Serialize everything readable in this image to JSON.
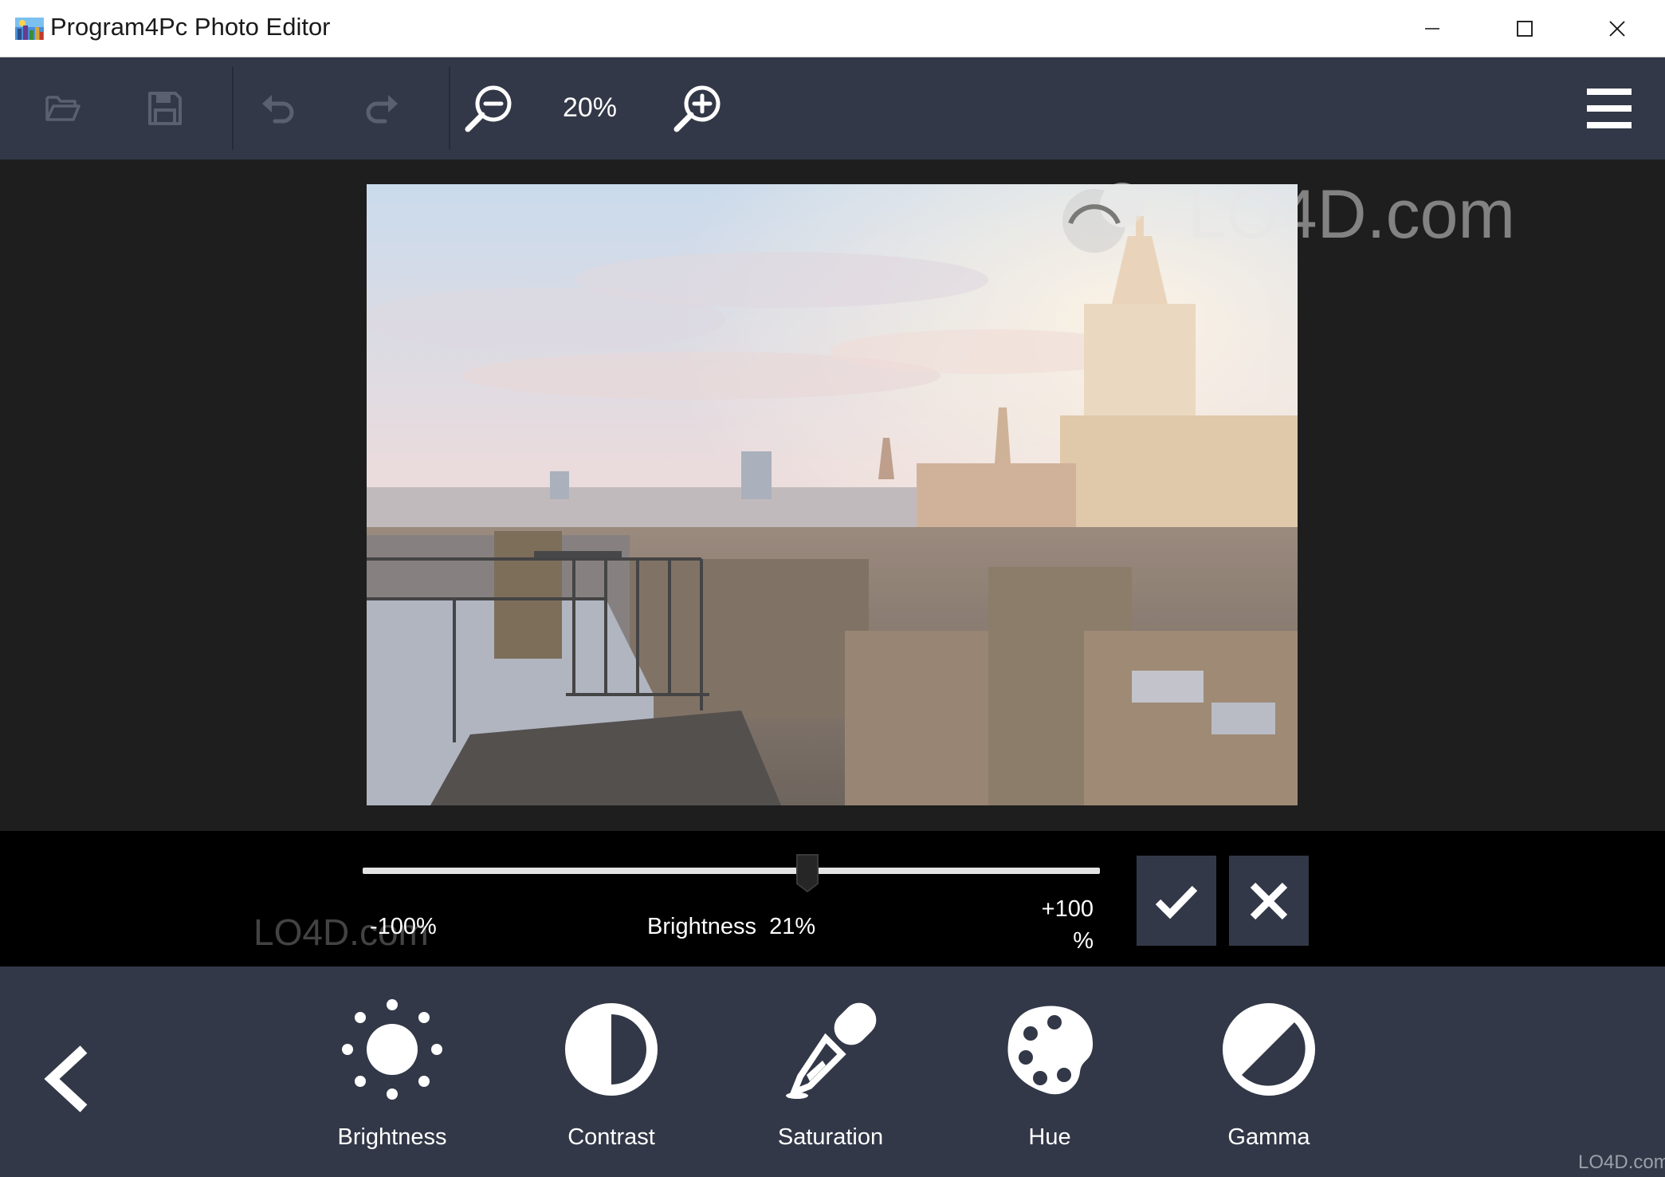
{
  "window": {
    "title": "Program4Pc Photo Editor",
    "controls": [
      "minimize",
      "maximize",
      "close"
    ]
  },
  "toolbar": {
    "icons": [
      "open-folder-icon",
      "save-icon",
      "undo-icon",
      "redo-icon",
      "zoom-out-icon",
      "zoom-in-icon",
      "hamburger-menu-icon"
    ],
    "zoom_level": "20%"
  },
  "adjustment": {
    "min_label": "-100%",
    "current_label": "Brightness",
    "current_value": "21%",
    "max_label": "+100",
    "max_unit": "%",
    "slider_value_percent": 21,
    "slider_min": -100,
    "slider_max": 100
  },
  "tools": [
    {
      "label": "Brightness",
      "icon": "sun-icon"
    },
    {
      "label": "Contrast",
      "icon": "contrast-icon"
    },
    {
      "label": "Saturation",
      "icon": "eyedropper-icon"
    },
    {
      "label": "Hue",
      "icon": "palette-icon"
    },
    {
      "label": "Gamma",
      "icon": "gamma-icon"
    }
  ],
  "watermark": {
    "text_main": "LO4D",
    "text_suffix": ".com"
  },
  "colors": {
    "toolbar_bg": "#323847",
    "canvas_bg": "#1e1e1e",
    "slider_panel_bg": "#000000"
  }
}
